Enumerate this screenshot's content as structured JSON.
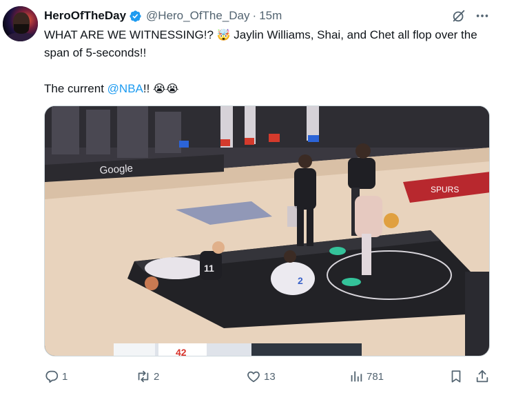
{
  "author": {
    "display_name": "HeroOfTheDay",
    "handle": "@Hero_OfThe_Day",
    "separator": "·",
    "time": "15m",
    "verified": true
  },
  "tweet": {
    "line1": "WHAT ARE WE WITNESSING!?",
    "emoji1": "🤯",
    "line1b": " Jaylin Williams, Shai, and Chet all flop over the span of 5-seconds!!",
    "line2_prefix": "The current ",
    "mention": "@NBA",
    "line2_suffix": "!! ",
    "emoji2": "😭😭"
  },
  "media": {
    "scoreboard_score": "42"
  },
  "metrics": {
    "replies": "1",
    "reposts": "2",
    "likes": "13",
    "views": "781"
  },
  "icons": {
    "verified": "verified-badge-icon",
    "grok": "grok-icon",
    "more": "more-icon",
    "reply": "reply-icon",
    "repost": "repost-icon",
    "like": "heart-icon",
    "views": "views-icon",
    "bookmark": "bookmark-icon",
    "share": "share-icon"
  },
  "colors": {
    "accent": "#1d9bf0",
    "text": "#0f1419",
    "secondary": "#536471"
  }
}
